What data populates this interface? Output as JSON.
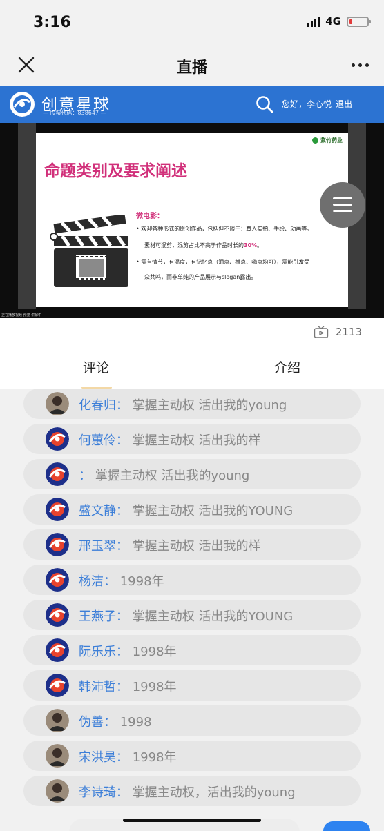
{
  "status_bar": {
    "time": "3:16",
    "network": "4G",
    "battery_level": 0.15,
    "battery_color": "#e23b3b"
  },
  "nav": {
    "title": "直播",
    "close_icon": "close-icon",
    "more_icon": "more-icon"
  },
  "brand": {
    "name": "创意星球",
    "stock_code": "— 股票代码：838647 —",
    "greeting": "您好，李心悦",
    "logout": "退出",
    "background": "#2c73d2"
  },
  "video": {
    "slide_logo": "紫竹药业",
    "slide_title": "命题类别及要求阐述",
    "slide_subtitle": "微电影：",
    "bullet1_line1": "•   欢迎各种形式的原创作品，包括但不限于：真人实拍、手绘、动画等。",
    "bullet1_line2_a": "素材可混剪，混剪占比不高于作品时长的",
    "bullet1_highlight": "30%",
    "bullet1_line2_b": "。",
    "bullet2_line1": "•   需有情节，有温度，有记忆点（泪点、槽点、嗨点均可），需能引发受",
    "bullet2_line2": "众共鸣，而非单纯的产品展示与slogan露出。",
    "caption": "正在播放视频 预览·讲解中"
  },
  "viewer_count": "2113",
  "tabs": {
    "comments": "评论",
    "intro": "介绍"
  },
  "comments": [
    {
      "name": "化春归",
      "sep": "：",
      "msg": "掌握主动权 活出我的young",
      "avatar": "photo"
    },
    {
      "name": "何蕙伶",
      "sep": "：",
      "msg": "掌握主动权 活出我的样",
      "avatar": "planet-logo"
    },
    {
      "name": "",
      "sep": "：",
      "msg": "掌握主动权 活出我的young",
      "avatar": "planet-logo"
    },
    {
      "name": "盛文静",
      "sep": "：",
      "msg": "掌握主动权 活出我的YOUNG",
      "avatar": "planet-logo"
    },
    {
      "name": "邢玉翠",
      "sep": "：",
      "msg": "掌握主动权 活出我的样",
      "avatar": "planet-logo"
    },
    {
      "name": "杨洁",
      "sep": "：",
      "msg": "1998年",
      "avatar": "planet-logo"
    },
    {
      "name": "王燕子",
      "sep": "：",
      "msg": "掌握主动权 活出我的YOUNG",
      "avatar": "planet-logo"
    },
    {
      "name": "阮乐乐",
      "sep": "：",
      "msg": "1998年",
      "avatar": "planet-logo"
    },
    {
      "name": "韩沛哲",
      "sep": "：",
      "msg": "1998年",
      "avatar": "planet-logo"
    },
    {
      "name": "伪善",
      "sep": "：",
      "msg": "1998",
      "avatar": "photo"
    },
    {
      "name": "宋洪昊",
      "sep": "：",
      "msg": "1998年",
      "avatar": "photo"
    },
    {
      "name": "李诗琦",
      "sep": "：",
      "msg": "掌握主动权，活出我的young",
      "avatar": "photo"
    }
  ]
}
